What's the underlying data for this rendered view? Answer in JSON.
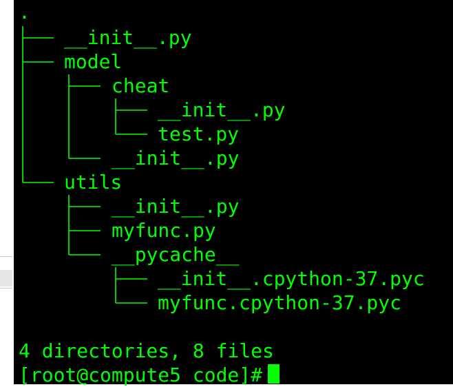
{
  "theme": {
    "background": "#000000",
    "foreground": "#00ff00"
  },
  "tree": {
    "root": ".",
    "entries": [
      {
        "name": "__init__.py"
      },
      {
        "name": "model"
      },
      {
        "name": "cheat"
      },
      {
        "name": "__init__.py"
      },
      {
        "name": "test.py"
      },
      {
        "name": "__init__.py"
      },
      {
        "name": "utils"
      },
      {
        "name": "__init__.py"
      },
      {
        "name": "myfunc.py"
      },
      {
        "name": "__pycache__"
      },
      {
        "name": "__init__.cpython-37.pyc"
      },
      {
        "name": "myfunc.cpython-37.pyc"
      }
    ]
  },
  "summary": "4 directories, 8 files",
  "prompt": "[root@compute5 code]#"
}
